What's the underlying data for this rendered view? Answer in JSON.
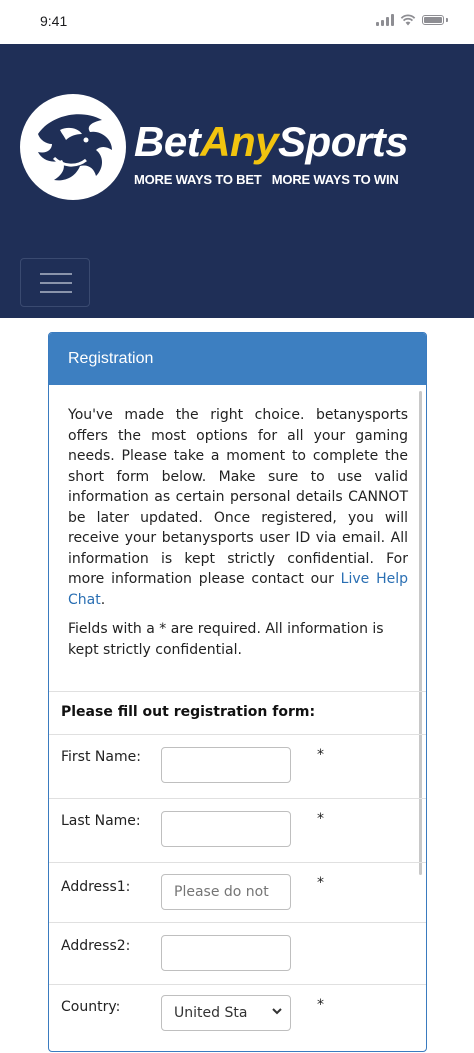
{
  "status_bar": {
    "time": "9:41"
  },
  "brand": {
    "name_part1": "Bet",
    "name_part2": "Any",
    "name_part3": "Sports",
    "tagline": "MORE WAYS TO BET   MORE WAYS TO WIN",
    "accent_color": "#f2c40f",
    "header_color": "#1f2f57"
  },
  "panel": {
    "title": "Registration",
    "intro_text": "You've made the right choice. betanysports offers the most options for all your gaming needs. Please take a moment to complete the short form below. Make sure to use valid information as certain personal details CANNOT be later updated. Once registered, you will receive your betanysports user ID via email. All information is kept strictly confidential. For more information please contact our ",
    "intro_link": "Live Help Chat",
    "intro_end": ".",
    "required_note": "Fields with a * are required. All information is kept strictly confidential.",
    "form_heading": "Please fill out registration form:"
  },
  "form": {
    "first_name": {
      "label": "First Name:",
      "value": "",
      "required": "*"
    },
    "last_name": {
      "label": "Last Name:",
      "value": "",
      "required": "*"
    },
    "address1": {
      "label": "Address1:",
      "placeholder": "Please do not",
      "required": "*"
    },
    "address2": {
      "label": "Address2:",
      "value": ""
    },
    "country": {
      "label": "Country:",
      "selected": "United Sta",
      "required": "*"
    }
  }
}
